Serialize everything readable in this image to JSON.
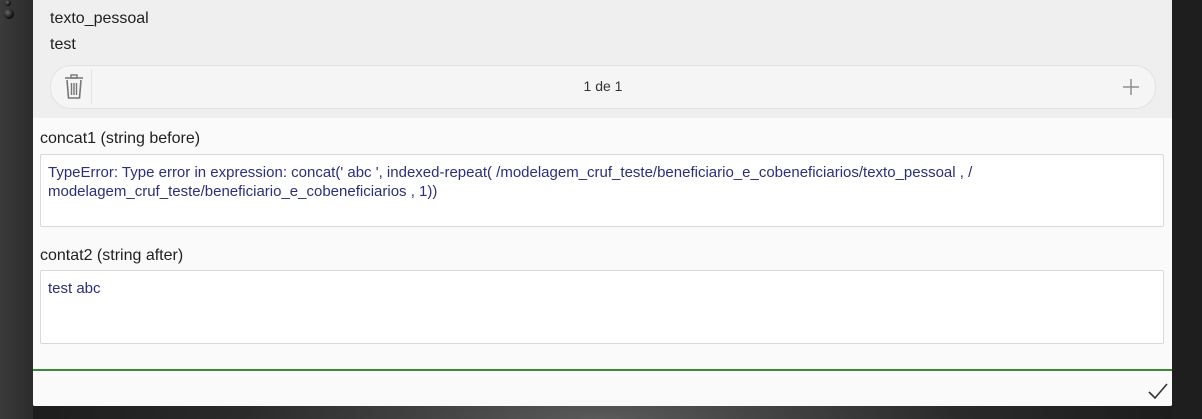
{
  "repeat_group": {
    "field_label": "texto_pessoal",
    "field_value": "test",
    "pager_text": "1 de 1"
  },
  "concat1": {
    "label": "concat1 (string before)",
    "value": "TypeError: Type error in expression: concat(' abc ', indexed-repeat( /modelagem_cruf_teste/beneficiario_e_cobeneficiarios/texto_pessoal ,  / modelagem_cruf_teste/beneficiario_e_cobeneficiarios , 1))"
  },
  "contat2": {
    "label": "contat2 (string after)",
    "value": "test abc"
  },
  "icons": {
    "delete": "trash-icon",
    "add": "plus-icon",
    "submit": "checkmark-icon"
  },
  "colors": {
    "value_text": "#2b2f7d",
    "accent_line": "#3f8a3a"
  }
}
